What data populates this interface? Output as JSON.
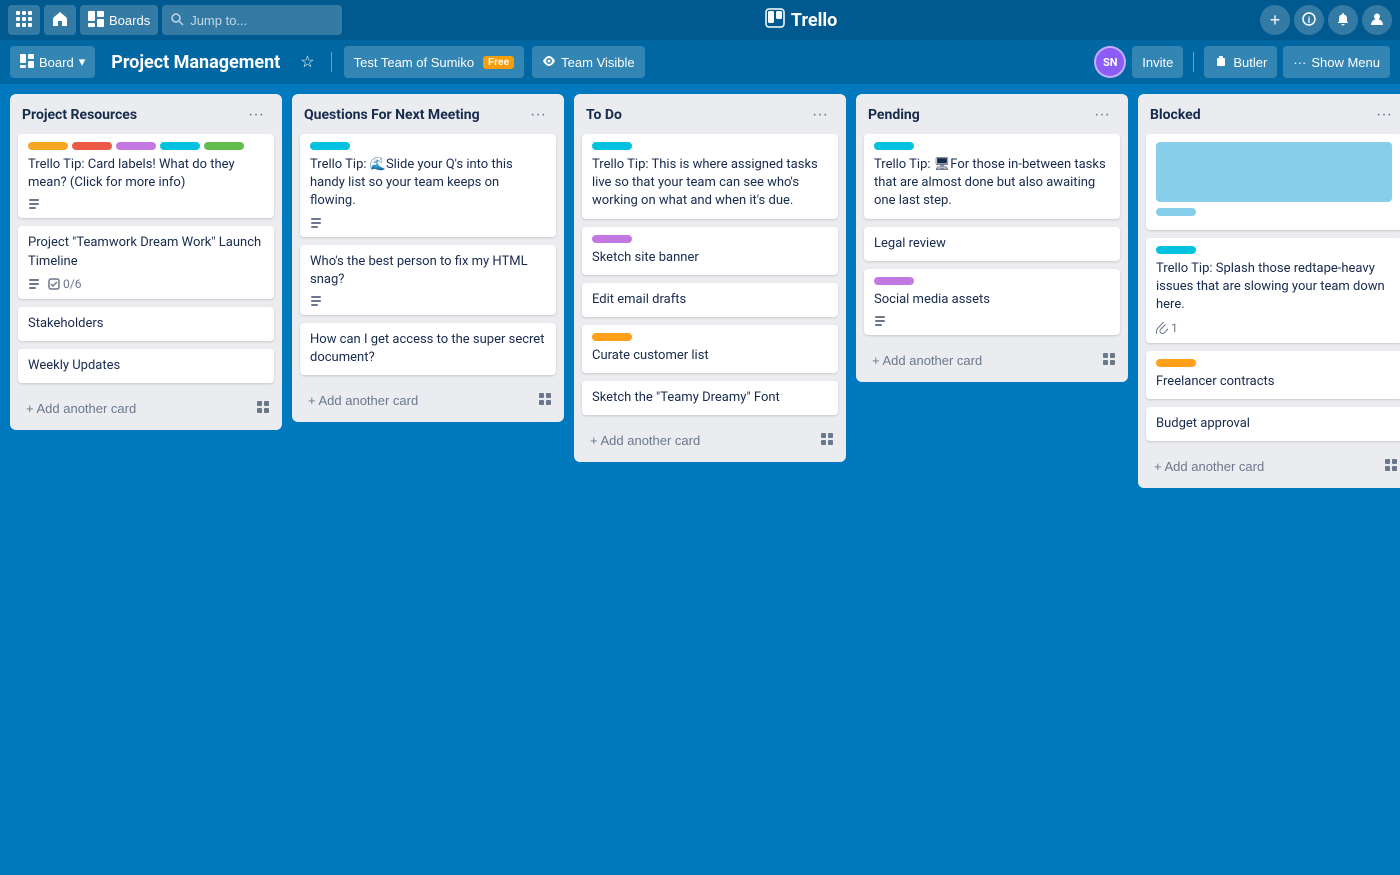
{
  "app": {
    "name": "Trello",
    "logo": "🗂"
  },
  "topnav": {
    "grid_icon": "⊞",
    "home_icon": "⌂",
    "boards_label": "Boards",
    "search_placeholder": "Jump to...",
    "plus_icon": "+",
    "info_icon": "ℹ",
    "bell_icon": "🔔",
    "person_icon": "👤"
  },
  "board_header": {
    "board_icon": "▦",
    "board_label": "Board",
    "chevron": "▾",
    "title": "Project Management",
    "star_icon": "☆",
    "team_label": "Test Team of Sumiko",
    "free_badge": "Free",
    "visibility_icon": "👁",
    "visibility_label": "Team Visible",
    "avatar_initials": "SN",
    "invite_label": "Invite",
    "butler_icon": "🤖",
    "butler_label": "Butler",
    "show_menu_label": "Show Menu",
    "dots": "···"
  },
  "lists": [
    {
      "id": "project-resources",
      "title": "Project Resources",
      "cards": [
        {
          "id": "pr-1",
          "labels": [
            "yellow",
            "red",
            "purple",
            "teal",
            "green"
          ],
          "text": "Trello Tip: Card labels! What do they mean? (Click for more info)",
          "has_desc": true
        },
        {
          "id": "pr-2",
          "labels": [],
          "text": "Project \"Teamwork Dream Work\" Launch Timeline",
          "has_desc": true,
          "has_checklist": true,
          "checklist_count": "0/6"
        },
        {
          "id": "pr-3",
          "labels": [],
          "text": "Stakeholders"
        },
        {
          "id": "pr-4",
          "labels": [],
          "text": "Weekly Updates"
        }
      ],
      "add_card_label": "+ Add another card"
    },
    {
      "id": "questions-next-meeting",
      "title": "Questions For Next Meeting",
      "cards": [
        {
          "id": "qm-1",
          "labels": [
            "cyan"
          ],
          "text": "Trello Tip: 🌊Slide your Q's into this handy list so your team keeps on flowing.",
          "has_desc": true
        },
        {
          "id": "qm-2",
          "labels": [],
          "text": "Who's the best person to fix my HTML snag?",
          "has_desc": true
        },
        {
          "id": "qm-3",
          "labels": [],
          "text": "How can I get access to the super secret document?"
        }
      ],
      "add_card_label": "+ Add another card"
    },
    {
      "id": "to-do",
      "title": "To Do",
      "cards": [
        {
          "id": "td-1",
          "labels": [
            "cyan"
          ],
          "text": "Trello Tip: This is where assigned tasks live so that your team can see who's working on what and when it's due."
        },
        {
          "id": "td-2",
          "labels": [
            "purple"
          ],
          "text": "Sketch site banner"
        },
        {
          "id": "td-3",
          "labels": [],
          "text": "Edit email drafts"
        },
        {
          "id": "td-4",
          "labels": [
            "orange"
          ],
          "text": "Curate customer list"
        },
        {
          "id": "td-5",
          "labels": [],
          "text": "Sketch the \"Teamy Dreamy\" Font"
        }
      ],
      "add_card_label": "+ Add another card"
    },
    {
      "id": "pending",
      "title": "Pending",
      "cards": [
        {
          "id": "pe-1",
          "labels": [
            "cyan"
          ],
          "text": "Trello Tip: 🖥For those in-between tasks that are almost done but also awaiting one last step."
        },
        {
          "id": "pe-2",
          "labels": [],
          "text": "Legal review"
        },
        {
          "id": "pe-3",
          "labels": [
            "purple"
          ],
          "text": "Social media assets",
          "has_desc": true
        }
      ],
      "add_card_label": "+ Add another card"
    },
    {
      "id": "blocked",
      "title": "Blocked",
      "cards": [
        {
          "id": "bl-1",
          "labels": [
            "light-blue"
          ],
          "text": "",
          "is_image": true
        },
        {
          "id": "bl-2",
          "labels": [
            "cyan"
          ],
          "text": "Trello Tip: Splash those redtape-heavy issues that are slowing your team down here.",
          "attachment_count": "1"
        },
        {
          "id": "bl-3",
          "labels": [
            "orange"
          ],
          "text": "Freelancer contracts"
        },
        {
          "id": "bl-4",
          "labels": [],
          "text": "Budget approval"
        }
      ],
      "add_card_label": "+ Add another card"
    }
  ]
}
